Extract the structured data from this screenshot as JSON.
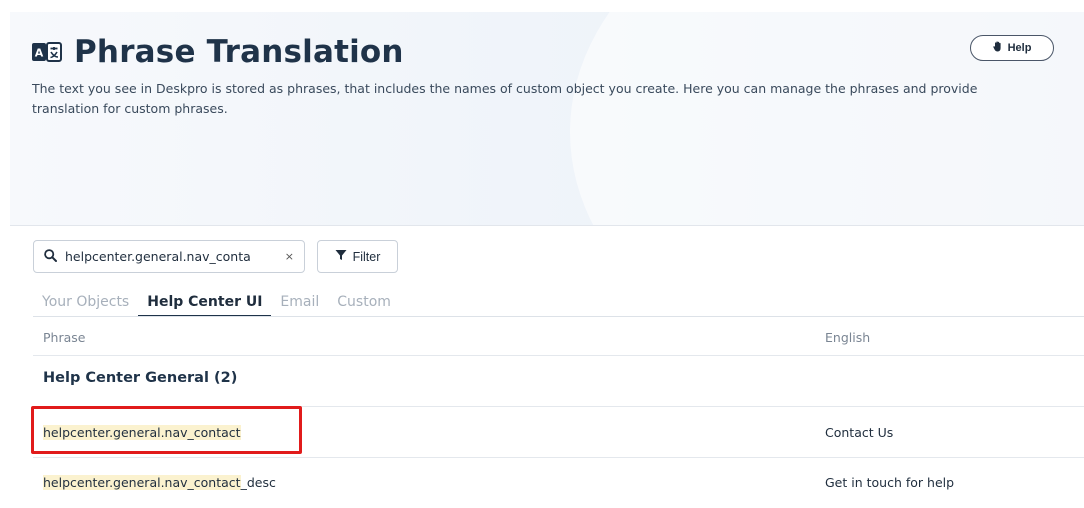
{
  "header": {
    "title": "Phrase Translation",
    "description": "The text you see in Deskpro is stored as phrases, that includes the names of custom object you create. Here you can manage the phrases and provide translation for custom phrases.",
    "help_label": "Help",
    "title_icon": "translate-icon",
    "help_icon": "hand-icon"
  },
  "toolbar": {
    "search_value": "helpcenter.general.nav_conta",
    "clear_label": "×",
    "filter_label": "Filter"
  },
  "tabs": [
    {
      "label": "Your Objects",
      "active": false
    },
    {
      "label": "Help Center UI",
      "active": true
    },
    {
      "label": "Email",
      "active": false
    },
    {
      "label": "Custom",
      "active": false
    }
  ],
  "table": {
    "columns": {
      "phrase": "Phrase",
      "english": "English"
    },
    "group_title": "Help Center General (2)",
    "rows": [
      {
        "phrase_match": "helpcenter.general.nav_contact",
        "phrase_rest": "",
        "english": "Contact Us"
      },
      {
        "phrase_match": "helpcenter.general.nav_contact",
        "phrase_rest": "_desc",
        "english": "Get in touch for help"
      }
    ]
  },
  "colors": {
    "highlight_border": "#e11b1b",
    "match_highlight": "#fbf2cf",
    "title": "#1f3349"
  }
}
